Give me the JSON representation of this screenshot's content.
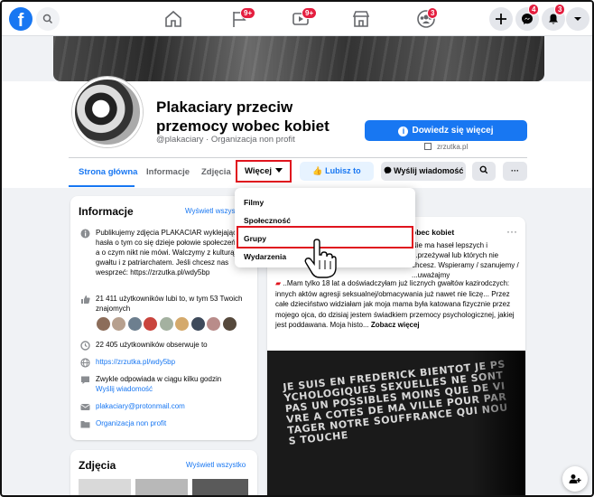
{
  "topbar": {
    "logo": "f",
    "badges": {
      "pages": "9+",
      "watch": "9+",
      "groups": "3",
      "messenger": "4",
      "notifications": "3"
    }
  },
  "page": {
    "title": "Plakaciary przeciw przemocy wobec kobiet",
    "handle": "@plakaciary · Organizacja non profit",
    "learn_more": "Dowiedz się więcej",
    "ext_link": "zrzutka.pl"
  },
  "tabs": {
    "home": "Strona główna",
    "info": "Informacje",
    "photos": "Zdjęcia",
    "more": "Więcej",
    "like": "Lubisz to",
    "message": "Wyślij wiadomość",
    "more_dots": "···"
  },
  "dropdown": {
    "items": [
      "Filmy",
      "Społeczność",
      "Grupy",
      "Wydarzenia"
    ]
  },
  "info": {
    "title": "Informacje",
    "see_all": "Wyświetl wszystko",
    "about": "Publikujemy zdjęcia PLAKACIAR wyklejających hasła o tym co się dzieje połowie społeczeństwa a o czym nikt nie mówi. Walczymy z kulturą gwałtu i z patriarchatem. Jeśli chcesz nas wesprzeć: https://zrzutka.pl/wdy5bp",
    "likes": "21 411 użytkowników lubi to, w tym 53 Twoich znajomych",
    "follows": "22 405 użytkowników obserwuje to",
    "website": "https://zrzutka.pl/wdy5bp",
    "response": "Zwykle odpowiada w ciągu kilku godzin",
    "send_message": "Wyślij wiadomość",
    "email": "plakaciary@protonmail.com",
    "category": "Organizacja non profit"
  },
  "photos": {
    "title": "Zdjęcia",
    "see_all": "Wyświetl wszystko"
  },
  "post": {
    "title_fragment": "obec kobiet",
    "dots": "···",
    "text1": "Nie ma haseł lepszych i ...przeżywał lub których nie chcesz. Wspieramy / szanujemy / ...uważajmy",
    "text2": "..Mam tylko 18 lat a doświadczyłam już licznych gwałtów kazirodczych: innych aktów agresji seksualnej/obmacywania już nawet nie liczę... Przez całe dzieciństwo widziałam jak moja mama była katowana fizycznie przez mojego ojca, do dzisiaj jestem świadkiem przemocy psychologicznej, jakiej jest poddawana. Moja histo...",
    "see_more": "Zobacz więcej",
    "image_text": "JE SUIS EN FREDERICK BIENTOT JE PSYCHOLOGIQUES SEXUELLES NE SONT PAS UN POSSIBLES MOINS QUE DE VIVRE A COTES DE MA VILLE POUR PARTAGER NOTRE SOUFFRANCE QUI NOUS TOUCHE"
  },
  "colors": {
    "fb_blue": "#1877f2",
    "highlight_red": "#e0141e",
    "badge_red": "#e41e3f"
  }
}
